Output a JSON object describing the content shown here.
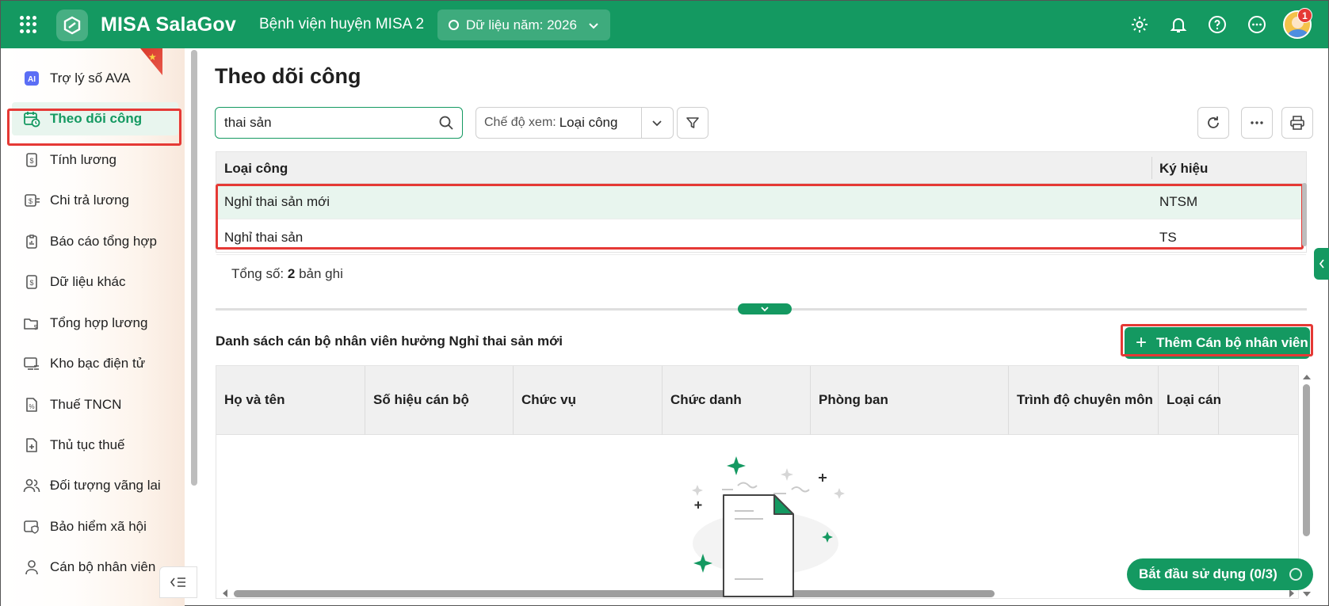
{
  "topbar": {
    "app_title": "MISA SalaGov",
    "org_name": "Bệnh viện huyện MISA 2",
    "year_label": "Dữ liệu năm: 2026",
    "notification_count": "1"
  },
  "sidebar": {
    "items": [
      {
        "label": "Trợ lý số AVA",
        "icon": "ai-icon"
      },
      {
        "label": "Theo dõi công",
        "icon": "calendar-clock-icon"
      },
      {
        "label": "Tính lương",
        "icon": "salary-doc-icon"
      },
      {
        "label": "Chi trả lương",
        "icon": "payment-icon"
      },
      {
        "label": "Báo cáo tổng hợp",
        "icon": "report-icon"
      },
      {
        "label": "Dữ liệu khác",
        "icon": "data-doc-icon"
      },
      {
        "label": "Tổng hợp lương",
        "icon": "folder-money-icon"
      },
      {
        "label": "Kho bạc điện tử",
        "icon": "treasury-icon"
      },
      {
        "label": "Thuế TNCN",
        "icon": "tax-doc-icon"
      },
      {
        "label": "Thủ tục thuế",
        "icon": "doc-plus-icon"
      },
      {
        "label": "Đối tượng vãng lai",
        "icon": "users-icon"
      },
      {
        "label": "Bảo hiểm xã hội",
        "icon": "shield-card-icon"
      },
      {
        "label": "Cán bộ nhân viên",
        "icon": "person-icon"
      }
    ],
    "active_index": 1
  },
  "main": {
    "page_title": "Theo dõi công",
    "search": {
      "value": "thai sản"
    },
    "view_mode": {
      "label": "Chế độ xem:",
      "value": "Loại công"
    },
    "table": {
      "columns": [
        "Loại công",
        "Ký hiệu"
      ],
      "rows": [
        [
          "Nghỉ thai sản mới",
          "NTSM"
        ],
        [
          "Nghỉ thai sản",
          "TS"
        ]
      ]
    },
    "total": {
      "prefix": "Tổng số:",
      "count": "2",
      "suffix": "bản ghi"
    },
    "list_title": "Danh sách cán bộ nhân viên hưởng Nghỉ thai sản mới",
    "add_button": "Thêm Cán bộ nhân viên",
    "staff_table": {
      "columns": [
        "Họ và tên",
        "Số hiệu cán bộ",
        "Chức vụ",
        "Chức danh",
        "Phòng ban",
        "Trình độ chuyên môn",
        "Loại cán"
      ]
    },
    "start_button": "Bắt đầu sử dụng (0/3)"
  },
  "colors": {
    "brand": "#149961",
    "highlight": "#e53935",
    "selected_row": "#e8f5ee"
  }
}
